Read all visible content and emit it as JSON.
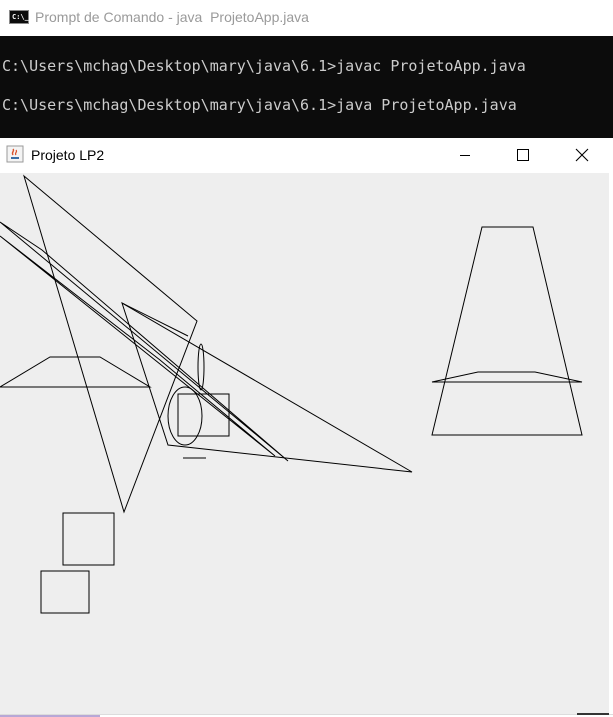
{
  "console": {
    "title": "Prompt de Comando - java  ProjetoApp.java",
    "icon": "command-prompt-icon",
    "lines": [
      "C:\\Users\\mchag\\Desktop\\mary\\java\\6.1>javac ProjetoApp.java",
      "C:\\Users\\mchag\\Desktop\\mary\\java\\6.1>java ProjetoApp.java"
    ],
    "colors": {
      "background": "#0c0c0c",
      "text": "#cccccc"
    }
  },
  "app": {
    "title": "Projeto LP2",
    "icon": "java-icon",
    "controls": [
      "minimize-icon",
      "maximize-icon",
      "close-icon"
    ],
    "canvas_color": "#eeeeee",
    "stroke_color": "#000000"
  }
}
